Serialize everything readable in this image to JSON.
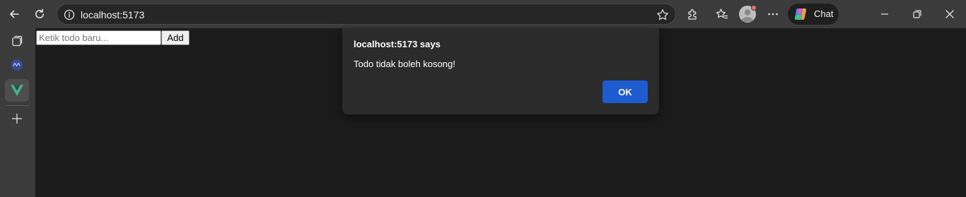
{
  "browser": {
    "url": "localhost:5173",
    "copilot_label": "Chat"
  },
  "page": {
    "todo_input_placeholder": "Ketik todo baru...",
    "todo_input_value": "",
    "add_label": "Add"
  },
  "dialog": {
    "title": "localhost:5173 says",
    "message": "Todo tidak boleh kosong!",
    "ok_label": "OK"
  },
  "colors": {
    "toolbar_bg": "#3b3b3b",
    "page_bg": "#1b1b1b",
    "dialog_bg": "#2b2b2b",
    "ok_button": "#1f5bd0",
    "vue_green": "#41b883"
  },
  "icons": {
    "toolbar": [
      "back-arrow-icon",
      "refresh-icon",
      "info-icon",
      "favorite-star-icon",
      "extensions-icon",
      "favorites-icon",
      "profile-avatar-icon",
      "more-options-icon",
      "copilot-icon",
      "minimize-icon",
      "restore-icon",
      "close-icon"
    ],
    "sidebar": [
      "tab-actions-icon",
      "sidebar-app-icon",
      "vue-logo-icon",
      "add-sidebar-item-icon"
    ]
  }
}
